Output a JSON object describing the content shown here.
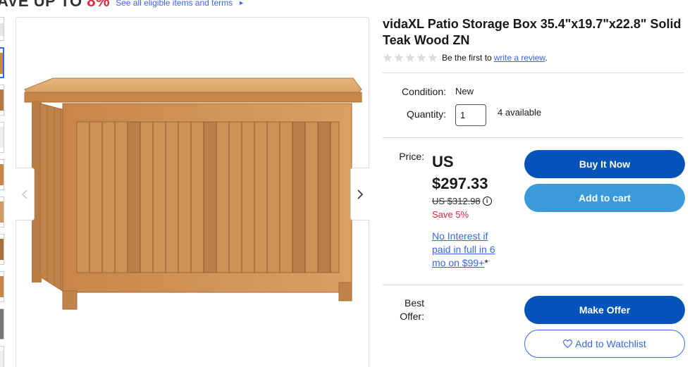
{
  "promo": {
    "headline_prefix": "AVE UP TO",
    "headline_percent": "8%",
    "link": "See all eligible items and terms",
    "arrow": "►"
  },
  "product": {
    "title": "vidaXL Patio Storage Box 35.4\"x19.7\"x22.8\" Solid Teak Wood ZN",
    "rating_prefix": "Be the first to",
    "rating_link": "write a review",
    "rating_suffix": "."
  },
  "condition": {
    "label": "Condition:",
    "value": "New"
  },
  "quantity": {
    "label": "Quantity:",
    "value": "1",
    "available": "4 available"
  },
  "price": {
    "label": "Price:",
    "currency": "US",
    "amount": "$297.33",
    "was": "US $312.98",
    "save": "Save 5%",
    "finance_link": "No Interest if paid in full in 6 mo on $99+",
    "finance_mark": "*"
  },
  "buttons": {
    "buy_now": "Buy It Now",
    "add_to_cart": "Add to cart",
    "make_offer": "Make Offer",
    "watchlist": "Add to Watchlist"
  },
  "best_offer": {
    "label_line1": "Best",
    "label_line2": "Offer:"
  },
  "icons": {
    "info": "info-icon",
    "heart": "heart-icon",
    "star": "star-icon",
    "chevron_left": "chevron-left-icon",
    "chevron_right": "chevron-right-icon"
  },
  "colors": {
    "primary_button": "#0654ba",
    "secondary_button": "#3b9ad9",
    "link": "#3665f3",
    "save": "#e0263c"
  }
}
